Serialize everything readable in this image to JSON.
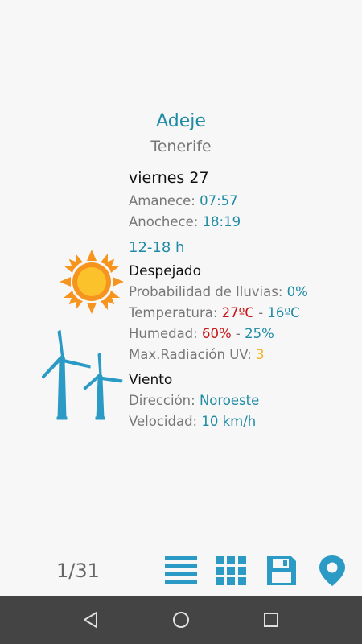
{
  "location": {
    "city": "Adeje",
    "region": "Tenerife"
  },
  "day": {
    "title": "viernes 27",
    "sunrise_label": "Amanece:",
    "sunrise_value": "07:57",
    "sunset_label": "Anochece:",
    "sunset_value": "18:19"
  },
  "period": {
    "hours": "12-18 h",
    "condition": "Despejado",
    "rain_label": "Probabilidad de lluvias:",
    "rain_value": "0%",
    "temp_label": "Temperatura:",
    "temp_max": "27ºC",
    "temp_sep": " - ",
    "temp_min": "16ºC",
    "humidity_label": "Humedad:",
    "humidity_max": "60%",
    "humidity_sep": " - ",
    "humidity_min": "25%",
    "uv_label": "Max.Radiación UV:",
    "uv_value": "3"
  },
  "wind": {
    "title": "Viento",
    "direction_label": "Dirección:",
    "direction_value": "Noroeste",
    "speed_label": "Velocidad:",
    "speed_value": "10 km/h"
  },
  "toolbar": {
    "page_counter": "1/31",
    "icons": [
      "list-icon",
      "grid-icon",
      "save-icon",
      "map-pin-icon"
    ]
  },
  "colors": {
    "accent": "#1f8ba5",
    "hot": "#c81414",
    "uv": "#f2b21d",
    "sun": "#f7941d",
    "sun_core": "#fcc22c",
    "nav_bar": "#444444"
  }
}
